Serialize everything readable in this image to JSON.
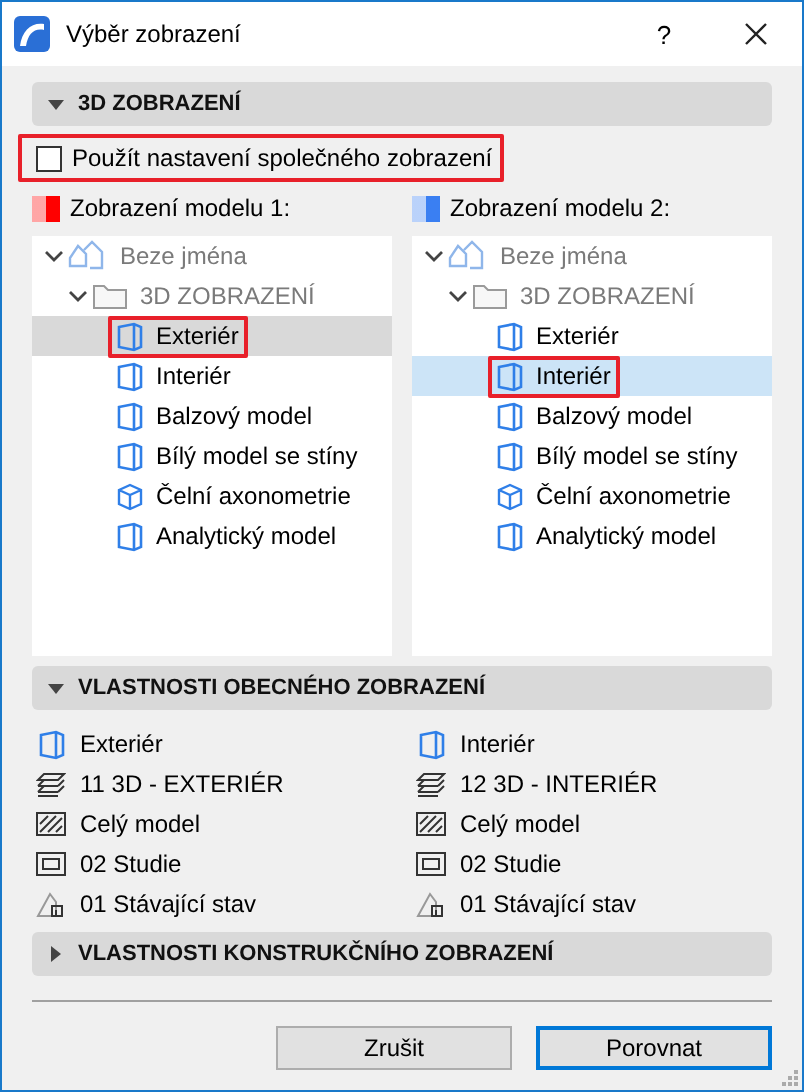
{
  "window": {
    "title": "Výběr zobrazení",
    "help": "?"
  },
  "section_3d": {
    "title": "3D ZOBRAZENÍ",
    "expanded": true
  },
  "use_common": {
    "label": "Použít nastavení společného zobrazení",
    "checked": false,
    "highlighted": true
  },
  "models": [
    {
      "label": "Zobrazení modelu 1:",
      "color": "#ff0000",
      "focused": false,
      "tree": {
        "label": "Beze jména",
        "kind": "project",
        "expanded": true,
        "children": [
          {
            "label": "3D ZOBRAZENÍ",
            "kind": "folder",
            "expanded": true,
            "children": [
              {
                "label": "Exteriér",
                "kind": "view",
                "selected": true,
                "highlighted": true
              },
              {
                "label": "Interiér",
                "kind": "view",
                "selected": false,
                "highlighted": false
              },
              {
                "label": "Balzový model",
                "kind": "view",
                "selected": false,
                "highlighted": false
              },
              {
                "label": "Bílý model se stíny",
                "kind": "view",
                "selected": false,
                "highlighted": false
              },
              {
                "label": "Čelní axonometrie",
                "kind": "axonometry",
                "selected": false,
                "highlighted": false
              },
              {
                "label": "Analytický model",
                "kind": "view",
                "selected": false,
                "highlighted": false
              }
            ]
          }
        ]
      }
    },
    {
      "label": "Zobrazení modelu 2:",
      "color": "#3a7ff2",
      "focused": true,
      "tree": {
        "label": "Beze jména",
        "kind": "project",
        "expanded": true,
        "children": [
          {
            "label": "3D ZOBRAZENÍ",
            "kind": "folder",
            "expanded": true,
            "children": [
              {
                "label": "Exteriér",
                "kind": "view",
                "selected": false,
                "highlighted": false
              },
              {
                "label": "Interiér",
                "kind": "view",
                "selected": true,
                "highlighted": true
              },
              {
                "label": "Balzový model",
                "kind": "view",
                "selected": false,
                "highlighted": false
              },
              {
                "label": "Bílý model se stíny",
                "kind": "view",
                "selected": false,
                "highlighted": false
              },
              {
                "label": "Čelní axonometrie",
                "kind": "axonometry",
                "selected": false,
                "highlighted": false
              },
              {
                "label": "Analytický model",
                "kind": "view",
                "selected": false,
                "highlighted": false
              }
            ]
          }
        ]
      }
    }
  ],
  "general_properties": {
    "title": "VLASTNOSTI OBECNÉHO ZOBRAZENÍ",
    "expanded": true,
    "columns": [
      [
        {
          "kind": "view",
          "text": "Exteriér"
        },
        {
          "kind": "layers",
          "text": "11 3D - EXTERIÉR"
        },
        {
          "kind": "model",
          "text": "Celý model"
        },
        {
          "kind": "pen",
          "text": "02 Studie"
        },
        {
          "kind": "renovation",
          "text": "01 Stávající stav"
        }
      ],
      [
        {
          "kind": "view",
          "text": "Interiér"
        },
        {
          "kind": "layers",
          "text": "12 3D - INTERIÉR"
        },
        {
          "kind": "model",
          "text": "Celý model"
        },
        {
          "kind": "pen",
          "text": "02 Studie"
        },
        {
          "kind": "renovation",
          "text": "01 Stávající stav"
        }
      ]
    ]
  },
  "construction_properties": {
    "title": "VLASTNOSTI KONSTRUKČNÍHO ZOBRAZENÍ",
    "expanded": false
  },
  "buttons": [
    {
      "label": "Zrušit",
      "default": false
    },
    {
      "label": "Porovnat",
      "default": true
    }
  ]
}
